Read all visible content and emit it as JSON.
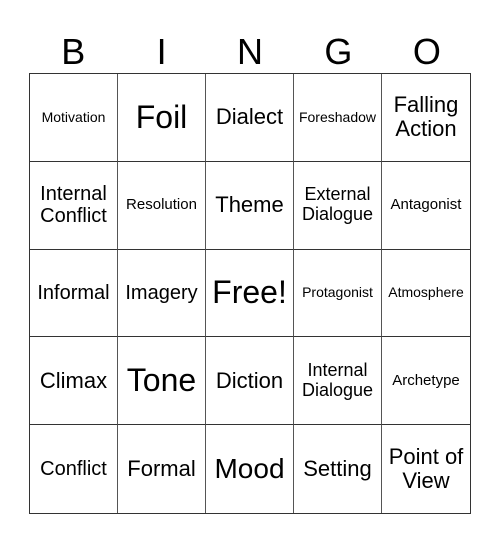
{
  "title_letters": [
    "B",
    "I",
    "N",
    "G",
    "O"
  ],
  "cells": [
    {
      "text": "Motivation",
      "size": "s14"
    },
    {
      "text": "Foil",
      "size": "s32"
    },
    {
      "text": "Dialect",
      "size": "s22"
    },
    {
      "text": "Foreshadow",
      "size": "s14"
    },
    {
      "text": "Falling Action",
      "size": "s22"
    },
    {
      "text": "Internal Conflict",
      "size": "s20"
    },
    {
      "text": "Resolution",
      "size": "s15"
    },
    {
      "text": "Theme",
      "size": "s22"
    },
    {
      "text": "External Dialogue",
      "size": "s18"
    },
    {
      "text": "Antagonist",
      "size": "s15"
    },
    {
      "text": "Informal",
      "size": "s20"
    },
    {
      "text": "Imagery",
      "size": "s20"
    },
    {
      "text": "Free!",
      "size": "s32"
    },
    {
      "text": "Protagonist",
      "size": "s14"
    },
    {
      "text": "Atmosphere",
      "size": "s14"
    },
    {
      "text": "Climax",
      "size": "s22"
    },
    {
      "text": "Tone",
      "size": "s32"
    },
    {
      "text": "Diction",
      "size": "s22"
    },
    {
      "text": "Internal Dialogue",
      "size": "s18"
    },
    {
      "text": "Archetype",
      "size": "s15"
    },
    {
      "text": "Conflict",
      "size": "s20"
    },
    {
      "text": "Formal",
      "size": "s22"
    },
    {
      "text": "Mood",
      "size": "s28"
    },
    {
      "text": "Setting",
      "size": "s22"
    },
    {
      "text": "Point of View",
      "size": "s22"
    }
  ]
}
